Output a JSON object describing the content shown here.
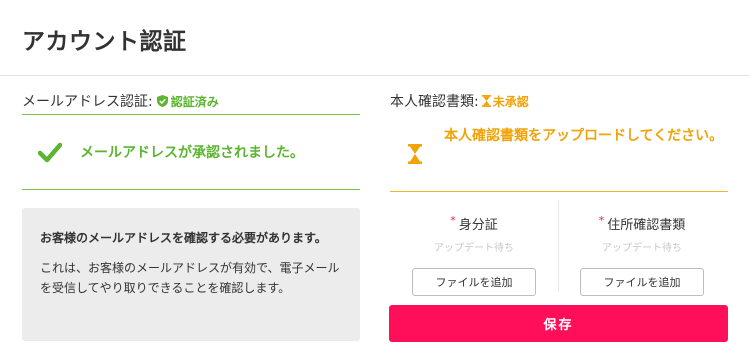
{
  "page": {
    "title": "アカウント認証"
  },
  "email_section": {
    "label": "メールアドレス認証:",
    "status": "認証済み",
    "message": "メールアドレスが承認されました。",
    "info_title": "お客様のメールアドレスを確認する必要があります。",
    "info_body": "これは、お客様のメールアドレスが有効で、電子メールを受信してやり取りできることを確認します。"
  },
  "identity_section": {
    "label": "本人確認書類:",
    "status": "未承認",
    "message": "本人確認書類をアップロードしてください。",
    "documents": [
      {
        "label": "身分証",
        "status": "アップデート待ち",
        "button": "ファイルを追加"
      },
      {
        "label": "住所確認書類",
        "status": "アップデート待ち",
        "button": "ファイルを追加"
      }
    ],
    "save_label": "保存"
  },
  "colors": {
    "verified_green": "#5cb531",
    "pending_orange": "#f0a30a",
    "save_pink": "#ff0f5a",
    "required_red": "#e8253a"
  },
  "icons": [
    "shield-check-icon",
    "hourglass-icon",
    "checkmark-icon"
  ]
}
